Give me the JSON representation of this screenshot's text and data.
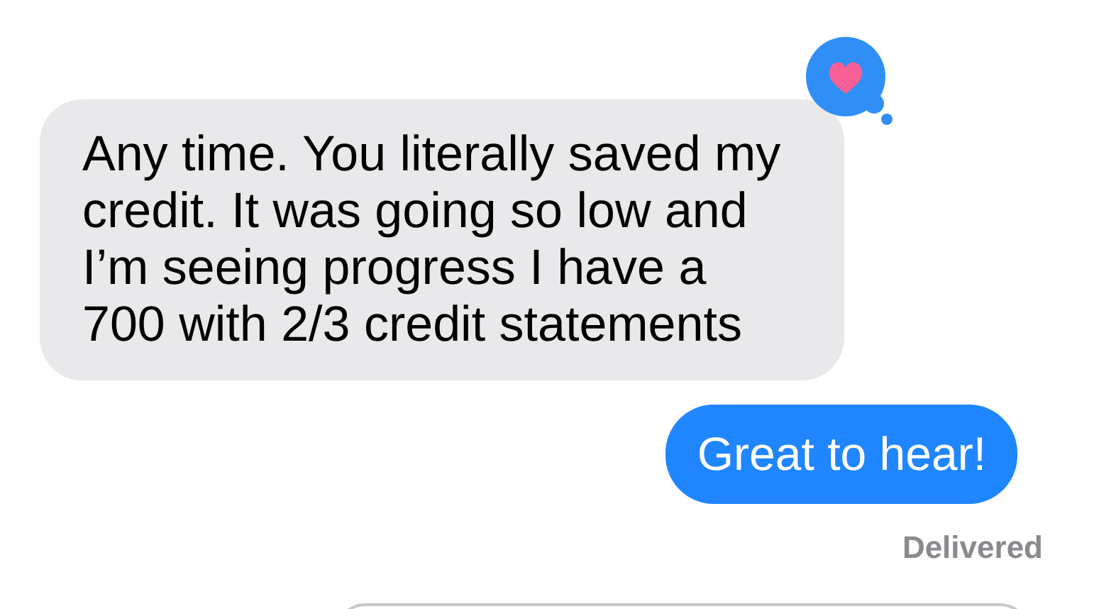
{
  "messages": [
    {
      "kind": "received",
      "text": "Any time. You literally saved my credit. It was going so low and I’m seeing progress I have a 700 with 2/3 credit statements",
      "hearted": true
    },
    {
      "kind": "sent",
      "text": "Great to hear!",
      "hearted": false
    }
  ],
  "status": "Delivered"
}
